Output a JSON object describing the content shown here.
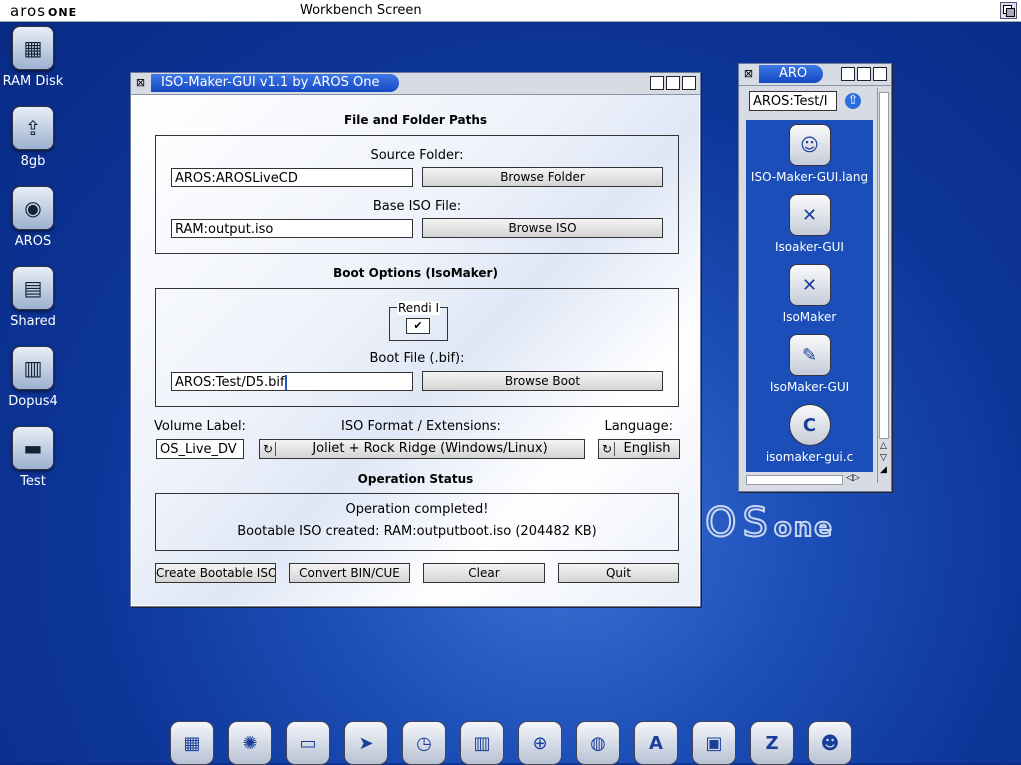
{
  "screen": {
    "logo": "aros",
    "logo_suffix": "ONE",
    "title": "Workbench Screen"
  },
  "desktop_icons": [
    {
      "label": "RAM Disk",
      "icon": "ram-disk-icon",
      "glyph": "▦"
    },
    {
      "label": "8gb",
      "icon": "usb-drive-icon",
      "glyph": "⇪"
    },
    {
      "label": "AROS",
      "icon": "hard-disk-icon",
      "glyph": "◉"
    },
    {
      "label": "Shared",
      "icon": "shared-drive-icon",
      "glyph": "▤"
    },
    {
      "label": "Dopus4",
      "icon": "dopus-icon",
      "glyph": "▥"
    },
    {
      "label": "Test",
      "icon": "drive-icon",
      "glyph": "▬"
    }
  ],
  "main_window": {
    "title": "ISO-Maker-GUI v1.1 by AROS One",
    "paths_title": "File and Folder Paths",
    "source_label": "Source Folder:",
    "source_value": "AROS:AROSLiveCD",
    "browse_folder": "Browse Folder",
    "base_iso_label": "Base ISO File:",
    "base_iso_value": "RAM:output.iso",
    "browse_iso": "Browse ISO",
    "boot_title": "Boot Options (IsoMaker)",
    "rendi_label": "Rendi I",
    "rendi_checked": "✔",
    "boot_file_label": "Boot File (.bif):",
    "boot_file_value": "AROS:Test/D5.bif",
    "browse_boot": "Browse Boot",
    "volume_label": "Volume Label:",
    "volume_value": "OS_Live_DV",
    "format_label": "ISO Format / Extensions:",
    "format_value": "Joliet + Rock Ridge (Windows/Linux)",
    "language_label": "Language:",
    "language_value": "English",
    "status_title": "Operation Status",
    "status_line1": "Operation completed!",
    "status_line2": "Bootable ISO created: RAM:outputboot.iso (204482 KB)",
    "btn_create": "Create Bootable ISO",
    "btn_convert": "Convert BIN/CUE",
    "btn_clear": "Clear",
    "btn_quit": "Quit"
  },
  "drawer": {
    "title": "ARO",
    "path": "AROS:Test/I",
    "items": [
      {
        "label": "ISO-Maker-GUI.lang",
        "icon": "catalog-icon",
        "glyph": "☺"
      },
      {
        "label": "Isoaker-GUI",
        "icon": "tool-icon",
        "glyph": "✕"
      },
      {
        "label": "IsoMaker",
        "icon": "tool-icon",
        "glyph": "✕"
      },
      {
        "label": "IsoMaker-GUI",
        "icon": "disc-icon",
        "glyph": "✎"
      },
      {
        "label": "isomaker-gui.c",
        "icon": "c-source-icon",
        "glyph": "C"
      }
    ]
  },
  "os_logo": {
    "main": "OS",
    "suffix": "one"
  },
  "dock": [
    {
      "icon": "workbench-icon",
      "glyph": "▦"
    },
    {
      "icon": "network-icon",
      "glyph": "✺"
    },
    {
      "icon": "display-icon",
      "glyph": "▭"
    },
    {
      "icon": "pointer-icon",
      "glyph": "➤"
    },
    {
      "icon": "clock-icon",
      "glyph": "◷"
    },
    {
      "icon": "keyboard-icon",
      "glyph": "▥"
    },
    {
      "icon": "cd-icon",
      "glyph": "⊕"
    },
    {
      "icon": "globe-icon",
      "glyph": "◍"
    },
    {
      "icon": "font-icon",
      "glyph": "A"
    },
    {
      "icon": "monitor-icon",
      "glyph": "▣"
    },
    {
      "icon": "zune-icon",
      "glyph": "Z"
    },
    {
      "icon": "user-icon",
      "glyph": "☻"
    }
  ]
}
